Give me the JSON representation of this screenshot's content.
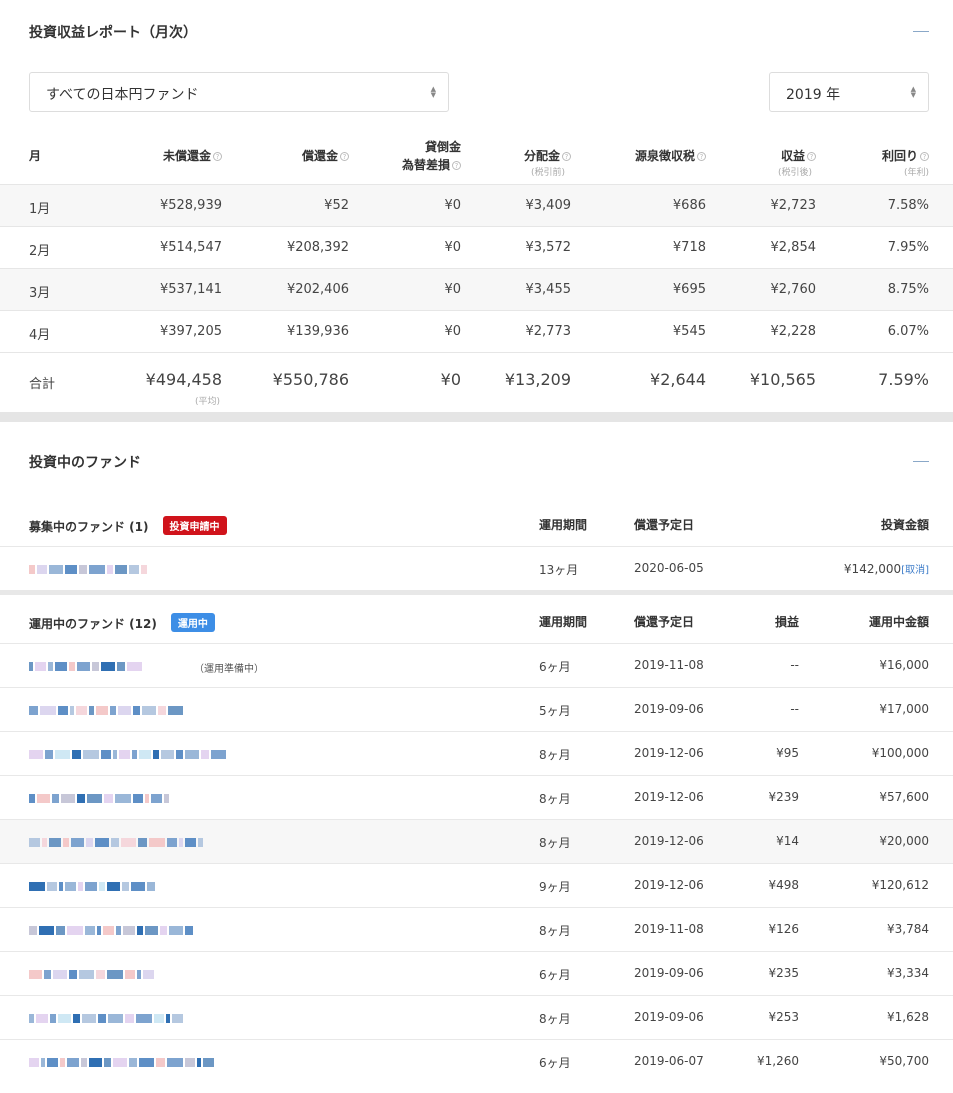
{
  "report": {
    "title": "投資収益レポート（月次）",
    "fund_select": "すべての日本円ファンド",
    "year_select": "2019 年",
    "headers": {
      "month": "月",
      "outstanding": "未償還金",
      "redemption": "償還金",
      "loss_line1": "貸倒金",
      "loss_line2": "為替差損",
      "distribution": "分配金",
      "distribution_sub": "(税引前)",
      "withholding": "源泉徴収税",
      "profit": "収益",
      "profit_sub": "(税引後)",
      "yield": "利回り",
      "yield_sub": "(年利)"
    },
    "rows": [
      {
        "month": "1月",
        "outstanding": "¥528,939",
        "redemption": "¥52",
        "loss": "¥0",
        "distribution": "¥3,409",
        "withholding": "¥686",
        "profit": "¥2,723",
        "yield": "7.58%"
      },
      {
        "month": "2月",
        "outstanding": "¥514,547",
        "redemption": "¥208,392",
        "loss": "¥0",
        "distribution": "¥3,572",
        "withholding": "¥718",
        "profit": "¥2,854",
        "yield": "7.95%"
      },
      {
        "month": "3月",
        "outstanding": "¥537,141",
        "redemption": "¥202,406",
        "loss": "¥0",
        "distribution": "¥3,455",
        "withholding": "¥695",
        "profit": "¥2,760",
        "yield": "8.75%"
      },
      {
        "month": "4月",
        "outstanding": "¥397,205",
        "redemption": "¥139,936",
        "loss": "¥0",
        "distribution": "¥2,773",
        "withholding": "¥545",
        "profit": "¥2,228",
        "yield": "6.07%"
      }
    ],
    "total": {
      "label": "合計",
      "outstanding": "¥494,458",
      "outstanding_sub": "(平均)",
      "redemption": "¥550,786",
      "loss": "¥0",
      "distribution": "¥13,209",
      "withholding": "¥2,644",
      "profit": "¥10,565",
      "yield": "7.59%"
    }
  },
  "funds": {
    "title": "投資中のファンド",
    "recruiting": {
      "label": "募集中のファンド (1)",
      "badge": "投資申請中",
      "col_period": "運用期間",
      "col_date": "償還予定日",
      "col_amount": "投資金額",
      "rows": [
        {
          "period": "13ヶ月",
          "date": "2020-06-05",
          "amount": "¥142,000",
          "cancel": "[取消]"
        }
      ]
    },
    "operating": {
      "label": "運用中のファンド (12)",
      "badge": "運用中",
      "col_period": "運用期間",
      "col_date": "償還予定日",
      "col_pl": "損益",
      "col_amount": "運用中金額",
      "prep_note": "（運用準備中）",
      "rows": [
        {
          "period": "6ヶ月",
          "date": "2019-11-08",
          "pl": "--",
          "amount": "¥16,000"
        },
        {
          "period": "5ヶ月",
          "date": "2019-09-06",
          "pl": "--",
          "amount": "¥17,000"
        },
        {
          "period": "8ヶ月",
          "date": "2019-12-06",
          "pl": "¥95",
          "amount": "¥100,000"
        },
        {
          "period": "8ヶ月",
          "date": "2019-12-06",
          "pl": "¥239",
          "amount": "¥57,600"
        },
        {
          "period": "8ヶ月",
          "date": "2019-12-06",
          "pl": "¥14",
          "amount": "¥20,000"
        },
        {
          "period": "9ヶ月",
          "date": "2019-12-06",
          "pl": "¥498",
          "amount": "¥120,612"
        },
        {
          "period": "8ヶ月",
          "date": "2019-11-08",
          "pl": "¥126",
          "amount": "¥3,784"
        },
        {
          "period": "6ヶ月",
          "date": "2019-09-06",
          "pl": "¥235",
          "amount": "¥3,334"
        },
        {
          "period": "8ヶ月",
          "date": "2019-09-06",
          "pl": "¥253",
          "amount": "¥1,628"
        },
        {
          "period": "6ヶ月",
          "date": "2019-06-07",
          "pl": "¥1,260",
          "amount": "¥50,700"
        }
      ]
    }
  },
  "colors": {
    "accent_red": "#d0131b",
    "accent_blue": "#3d8ee6",
    "link": "#3d7cc9"
  },
  "icons": {
    "collapse": "minus-icon",
    "select_arrows": "sort-arrows-icon",
    "help": "question-circle-icon"
  }
}
